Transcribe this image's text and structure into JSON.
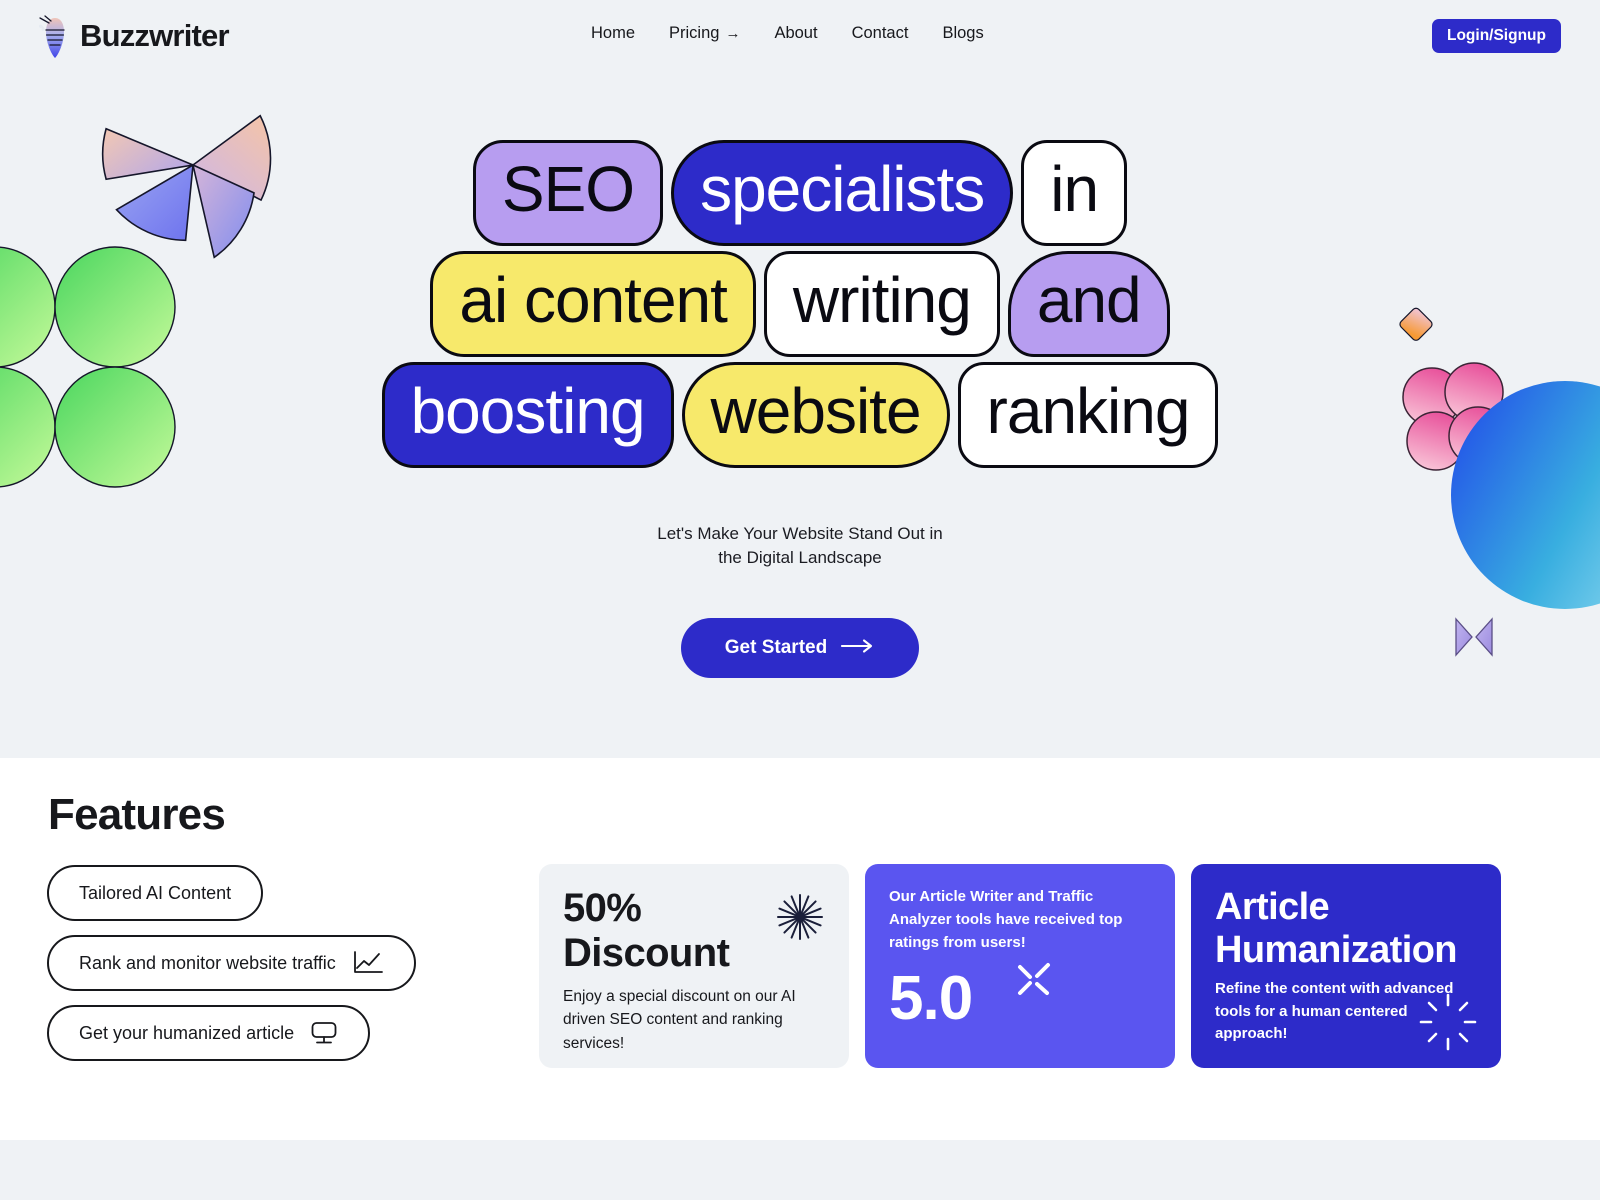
{
  "nav": {
    "brand": "Buzzwriter",
    "brand_icon": "bee-pen-logo-icon",
    "links": [
      {
        "label": "Home",
        "icon": null
      },
      {
        "label": "Pricing",
        "icon": "arrow-right-icon",
        "arrow": "→"
      },
      {
        "label": "About",
        "icon": null
      },
      {
        "label": "Contact",
        "icon": null
      },
      {
        "label": "Blogs",
        "icon": null
      }
    ],
    "login_label": "Login/Signup"
  },
  "hero": {
    "tiles": [
      [
        {
          "text": "SEO",
          "style": "t-seo",
          "color": "#b79df0"
        },
        {
          "text": "specialists",
          "style": "t-spec",
          "color": "#2d2bc9"
        },
        {
          "text": "in",
          "style": "t-in",
          "color": "#ffffff"
        }
      ],
      [
        {
          "text": "ai content",
          "style": "t-ai",
          "color": "#f7e96b"
        },
        {
          "text": "writing",
          "style": "t-writing",
          "color": "#ffffff"
        },
        {
          "text": "and",
          "style": "t-and",
          "color": "#b79df0"
        }
      ],
      [
        {
          "text": "boosting",
          "style": "t-boost",
          "color": "#2d2bc9"
        },
        {
          "text": "website",
          "style": "t-website",
          "color": "#f7e96b"
        },
        {
          "text": "ranking",
          "style": "t-ranking",
          "color": "#ffffff"
        }
      ]
    ],
    "subtitle_line1": "Let's Make Your Website Stand Out in",
    "subtitle_line2": "the Digital Landscape",
    "cta_label": "Get Started",
    "cta_arrow": "⟶",
    "decorations": [
      "pinwheel-shape",
      "green-circles-shape",
      "orange-diamond-shape",
      "pink-clover-shape",
      "blue-gradient-sphere-shape",
      "purple-bowtie-shape"
    ]
  },
  "features": {
    "title": "Features",
    "pills": [
      {
        "label": "Tailored AI Content",
        "icon": null
      },
      {
        "label": "Rank and monitor website traffic",
        "icon": "line-chart-icon"
      },
      {
        "label": "Get your humanized article",
        "icon": "monitor-icon"
      }
    ],
    "cards": [
      {
        "id": "discount-card",
        "title_line1": "50%",
        "title_line2": "Discount",
        "desc": "Enjoy a special discount on our AI driven SEO content and ranking services!",
        "icon": "starburst-icon",
        "bg": "#eff2f5"
      },
      {
        "id": "rating-card",
        "desc": "Our Article Writer and Traffic Analyzer tools have received top ratings from users!",
        "score": "5.0",
        "icon": "sparkle-icon",
        "bg": "#5a55f0"
      },
      {
        "id": "humanization-card",
        "title_line1": "Article",
        "title_line2": "Humanization",
        "desc": "Refine the content with advanced tools for a human centered approach!",
        "icon": "sun-rays-icon",
        "bg": "#2d2bc9"
      }
    ]
  },
  "colors": {
    "hero_bg": "#eff2f5",
    "accent_blue": "#2d2bc9",
    "accent_indigo": "#5a55f0",
    "accent_purple": "#b79df0",
    "accent_yellow": "#f7e96b",
    "ink": "#17181c"
  }
}
